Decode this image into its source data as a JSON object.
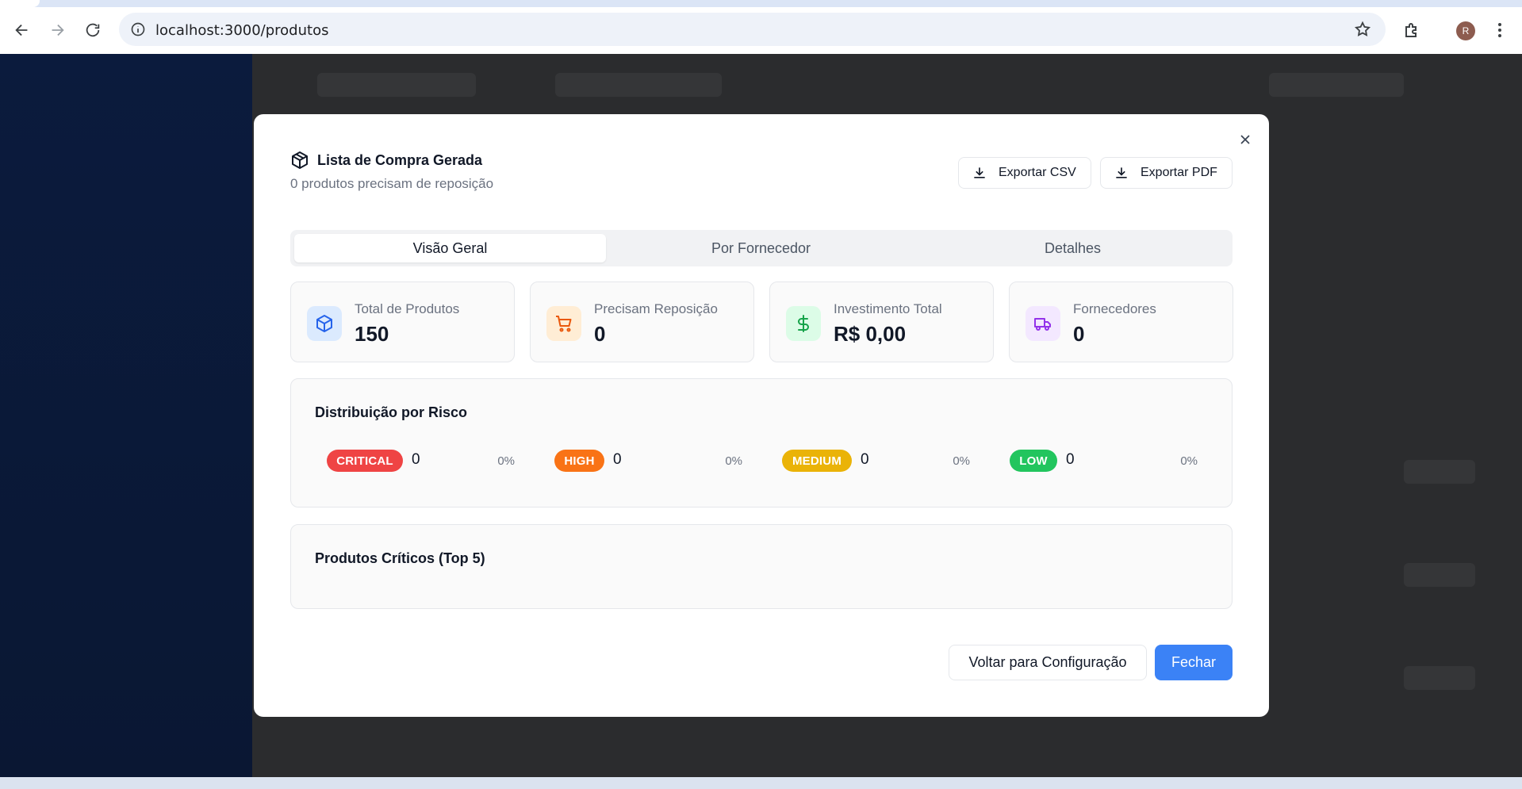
{
  "browser": {
    "url": "localhost:3000/produtos",
    "avatar_initial": "R"
  },
  "modal": {
    "title": "Lista de Compra Gerada",
    "subtitle": "0 produtos precisam de reposição",
    "export_csv_label": "Exportar CSV",
    "export_pdf_label": "Exportar PDF",
    "tabs": [
      {
        "label": "Visão Geral",
        "active": true
      },
      {
        "label": "Por Fornecedor",
        "active": false
      },
      {
        "label": "Detalhes",
        "active": false
      }
    ],
    "cards": [
      {
        "label": "Total de Produtos",
        "value": "150",
        "icon": "package-icon",
        "color": "#2563eb",
        "bg": "#dbeafe"
      },
      {
        "label": "Precisam Reposição",
        "value": "0",
        "icon": "cart-icon",
        "color": "#ea580c",
        "bg": "#ffedd5"
      },
      {
        "label": "Investimento Total",
        "value": "R$ 0,00",
        "icon": "dollar-icon",
        "color": "#16a34a",
        "bg": "#dcfce7"
      },
      {
        "label": "Fornecedores",
        "value": "0",
        "icon": "truck-icon",
        "color": "#9333ea",
        "bg": "#f3e8ff"
      }
    ],
    "risk_section": {
      "title": "Distribuição por Risco",
      "items": [
        {
          "label": "CRITICAL",
          "count": "0",
          "percent": "0%",
          "color": "#ef4444"
        },
        {
          "label": "HIGH",
          "count": "0",
          "percent": "0%",
          "color": "#f97316"
        },
        {
          "label": "MEDIUM",
          "count": "0",
          "percent": "0%",
          "color": "#eab308"
        },
        {
          "label": "LOW",
          "count": "0",
          "percent": "0%",
          "color": "#22c55e"
        }
      ]
    },
    "critical_section": {
      "title": "Produtos Críticos (Top 5)"
    },
    "back_label": "Voltar para Configuração",
    "close_label": "Fechar",
    "accent": "#3b82f6"
  }
}
